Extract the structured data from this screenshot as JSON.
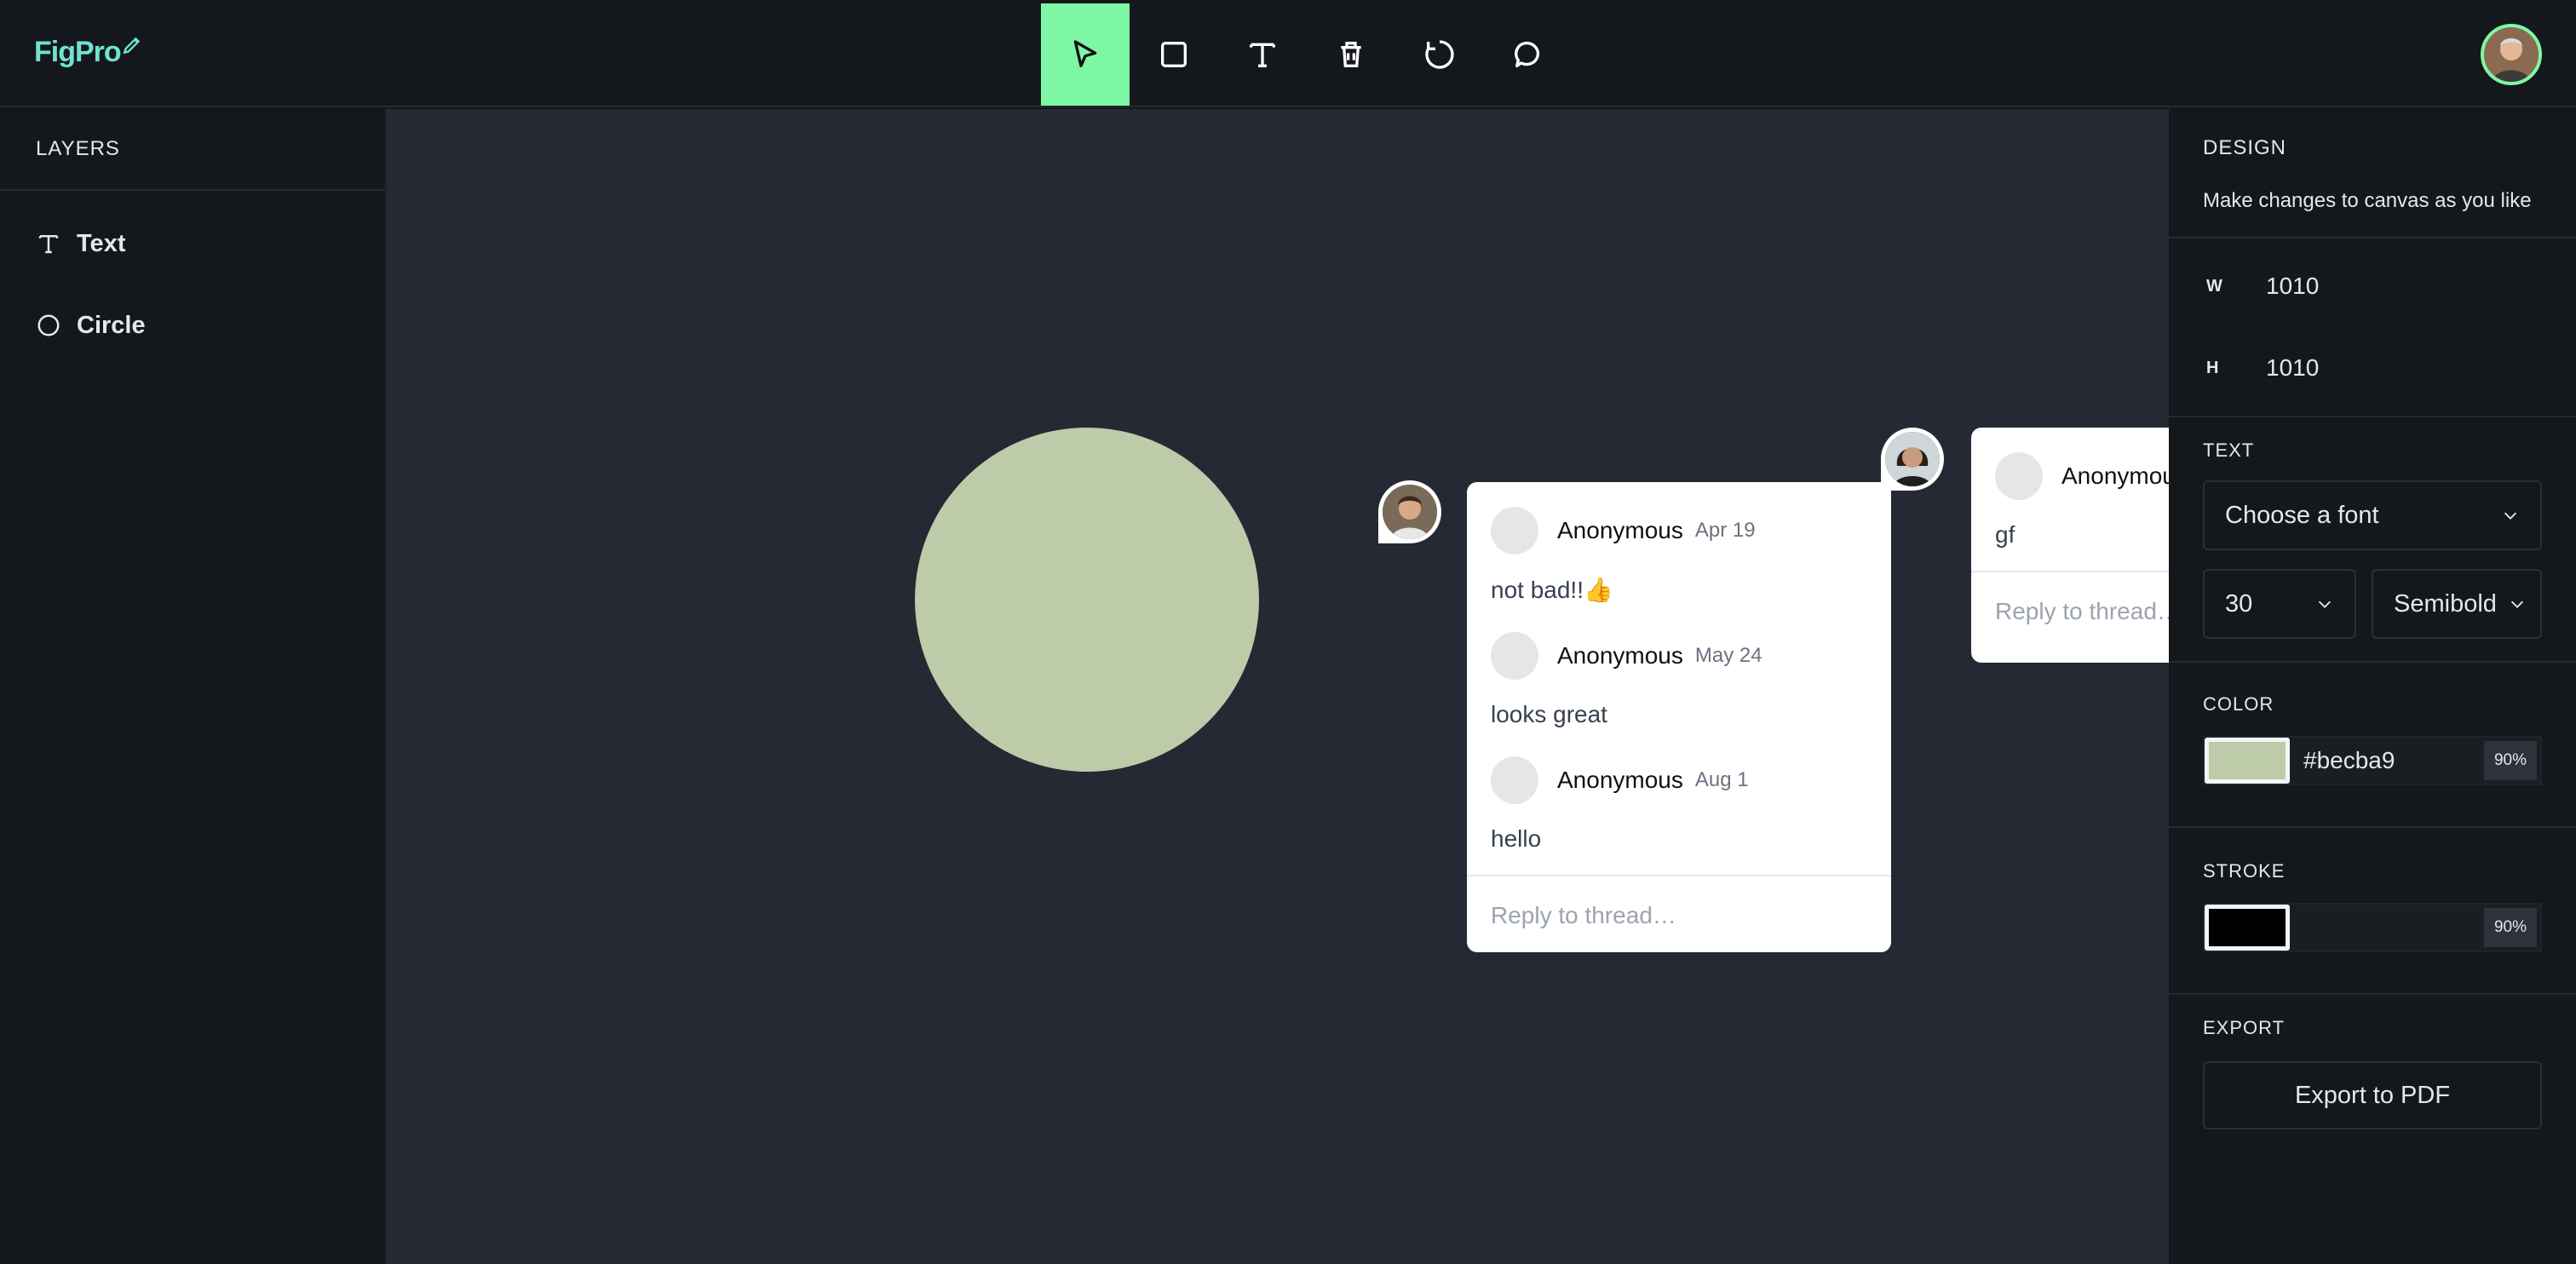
{
  "app": {
    "logo": "FigPro"
  },
  "toolbar": {
    "tools": [
      {
        "name": "select",
        "icon": "cursor-icon",
        "active": true
      },
      {
        "name": "rectangle",
        "icon": "square-icon",
        "active": false
      },
      {
        "name": "text",
        "icon": "text-icon",
        "active": false
      },
      {
        "name": "delete",
        "icon": "trash-icon",
        "active": false
      },
      {
        "name": "reset",
        "icon": "reset-icon",
        "active": false
      },
      {
        "name": "comments",
        "icon": "comment-icon",
        "active": false
      }
    ],
    "accent": "#7ef7a5"
  },
  "layers": {
    "title": "LAYERS",
    "items": [
      {
        "label": "Text",
        "icon": "text-icon"
      },
      {
        "label": "Circle",
        "icon": "circle-icon"
      }
    ]
  },
  "canvas": {
    "background": "#252933",
    "circle_fill": "#becba9"
  },
  "threads": [
    {
      "comments": [
        {
          "author": "Anonymous",
          "date": "Apr 19",
          "body": "not bad!!👍"
        },
        {
          "author": "Anonymous",
          "date": "May 24",
          "body": "looks great"
        },
        {
          "author": "Anonymous",
          "date": "Aug 1",
          "body": "hello"
        }
      ],
      "reply_placeholder": "Reply to thread…"
    },
    {
      "comments": [
        {
          "author": "Anonymous",
          "date": "",
          "body": "gf"
        }
      ],
      "reply_placeholder": "Reply to thread…"
    }
  ],
  "design": {
    "title": "DESIGN",
    "subtitle": "Make changes to canvas as you like",
    "w_label": "W",
    "w_value": "1010",
    "h_label": "H",
    "h_value": "1010",
    "text_title": "TEXT",
    "font_placeholder": "Choose a font",
    "font_size": "30",
    "font_weight": "Semibold",
    "color_title": "COLOR",
    "fill_hex": "#becba9",
    "fill_opacity": "90%",
    "stroke_title": "STROKE",
    "stroke_color": "#000000",
    "stroke_opacity": "90%",
    "export_title": "EXPORT",
    "export_label": "Export to PDF"
  }
}
